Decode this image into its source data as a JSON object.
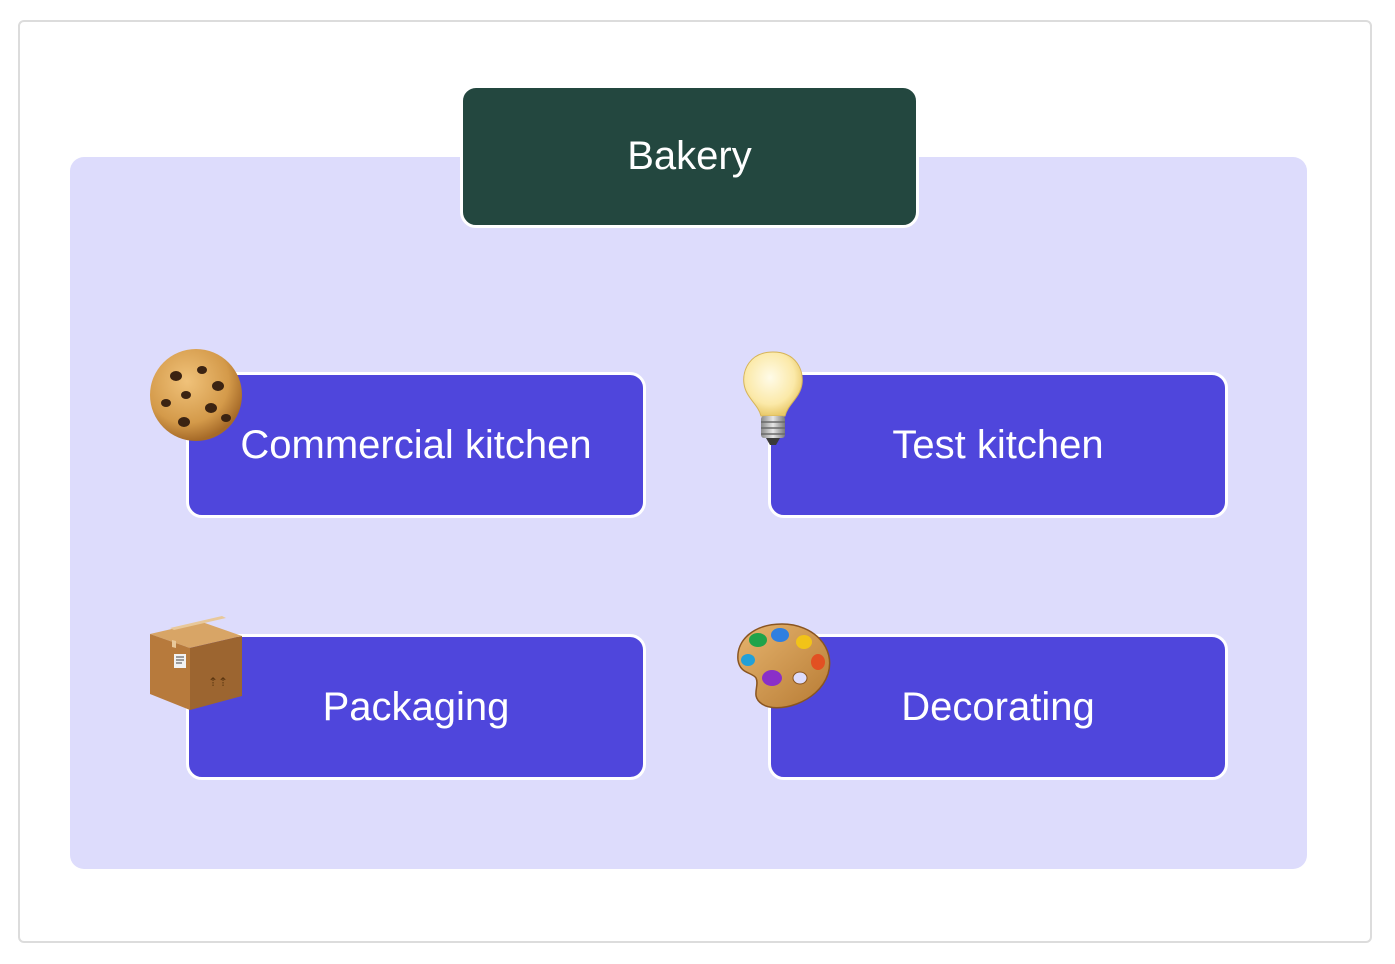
{
  "diagram": {
    "title": "Bakery",
    "nodes": [
      {
        "label": "Commercial kitchen",
        "icon": "cookie-icon"
      },
      {
        "label": "Test kitchen",
        "icon": "lightbulb-icon"
      },
      {
        "label": "Packaging",
        "icon": "package-box-icon"
      },
      {
        "label": "Decorating",
        "icon": "artist-palette-icon"
      }
    ]
  },
  "colors": {
    "title_fill": "#23473f",
    "node_fill": "#4f46dc",
    "group_fill": "#dddcfc",
    "text": "#ffffff"
  }
}
